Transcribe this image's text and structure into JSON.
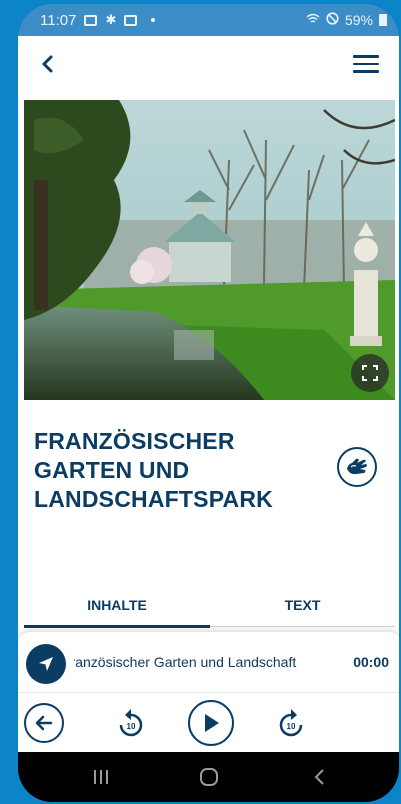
{
  "status_bar": {
    "time": "11:07",
    "battery": "59%"
  },
  "app_bar": {
    "back_icon": "chevron-left-icon",
    "menu_icon": "hamburger-menu-icon"
  },
  "hero": {
    "image_subject": "park-pavilion-pond-photo",
    "fullscreen_icon": "fullscreen-icon"
  },
  "title": "FRANZÖSISCHER GARTEN UND LANDSCHAFTSPARK",
  "sign_language_icon": "sign-language-hand-icon",
  "tabs": [
    {
      "label": "INHALTE",
      "active": true
    },
    {
      "label": "TEXT",
      "active": false
    }
  ],
  "player": {
    "track_title": "Französischer Garten und Landschaft",
    "time": "00:00",
    "navigation_icon": "navigation-arrow-icon"
  },
  "controls": {
    "back_icon": "arrow-left-circle-icon",
    "rewind_icon": "rewind-10-icon",
    "rewind_seconds": "10",
    "play_icon": "play-icon",
    "forward_icon": "forward-10-icon",
    "forward_seconds": "10"
  },
  "system_nav": {
    "recent_icon": "recent-apps-icon",
    "home_icon": "home-icon",
    "back_icon": "back-icon"
  },
  "colors": {
    "primary": "#0b3c63",
    "status_bar": "#3c8cc8",
    "background": "#0b84c8"
  }
}
